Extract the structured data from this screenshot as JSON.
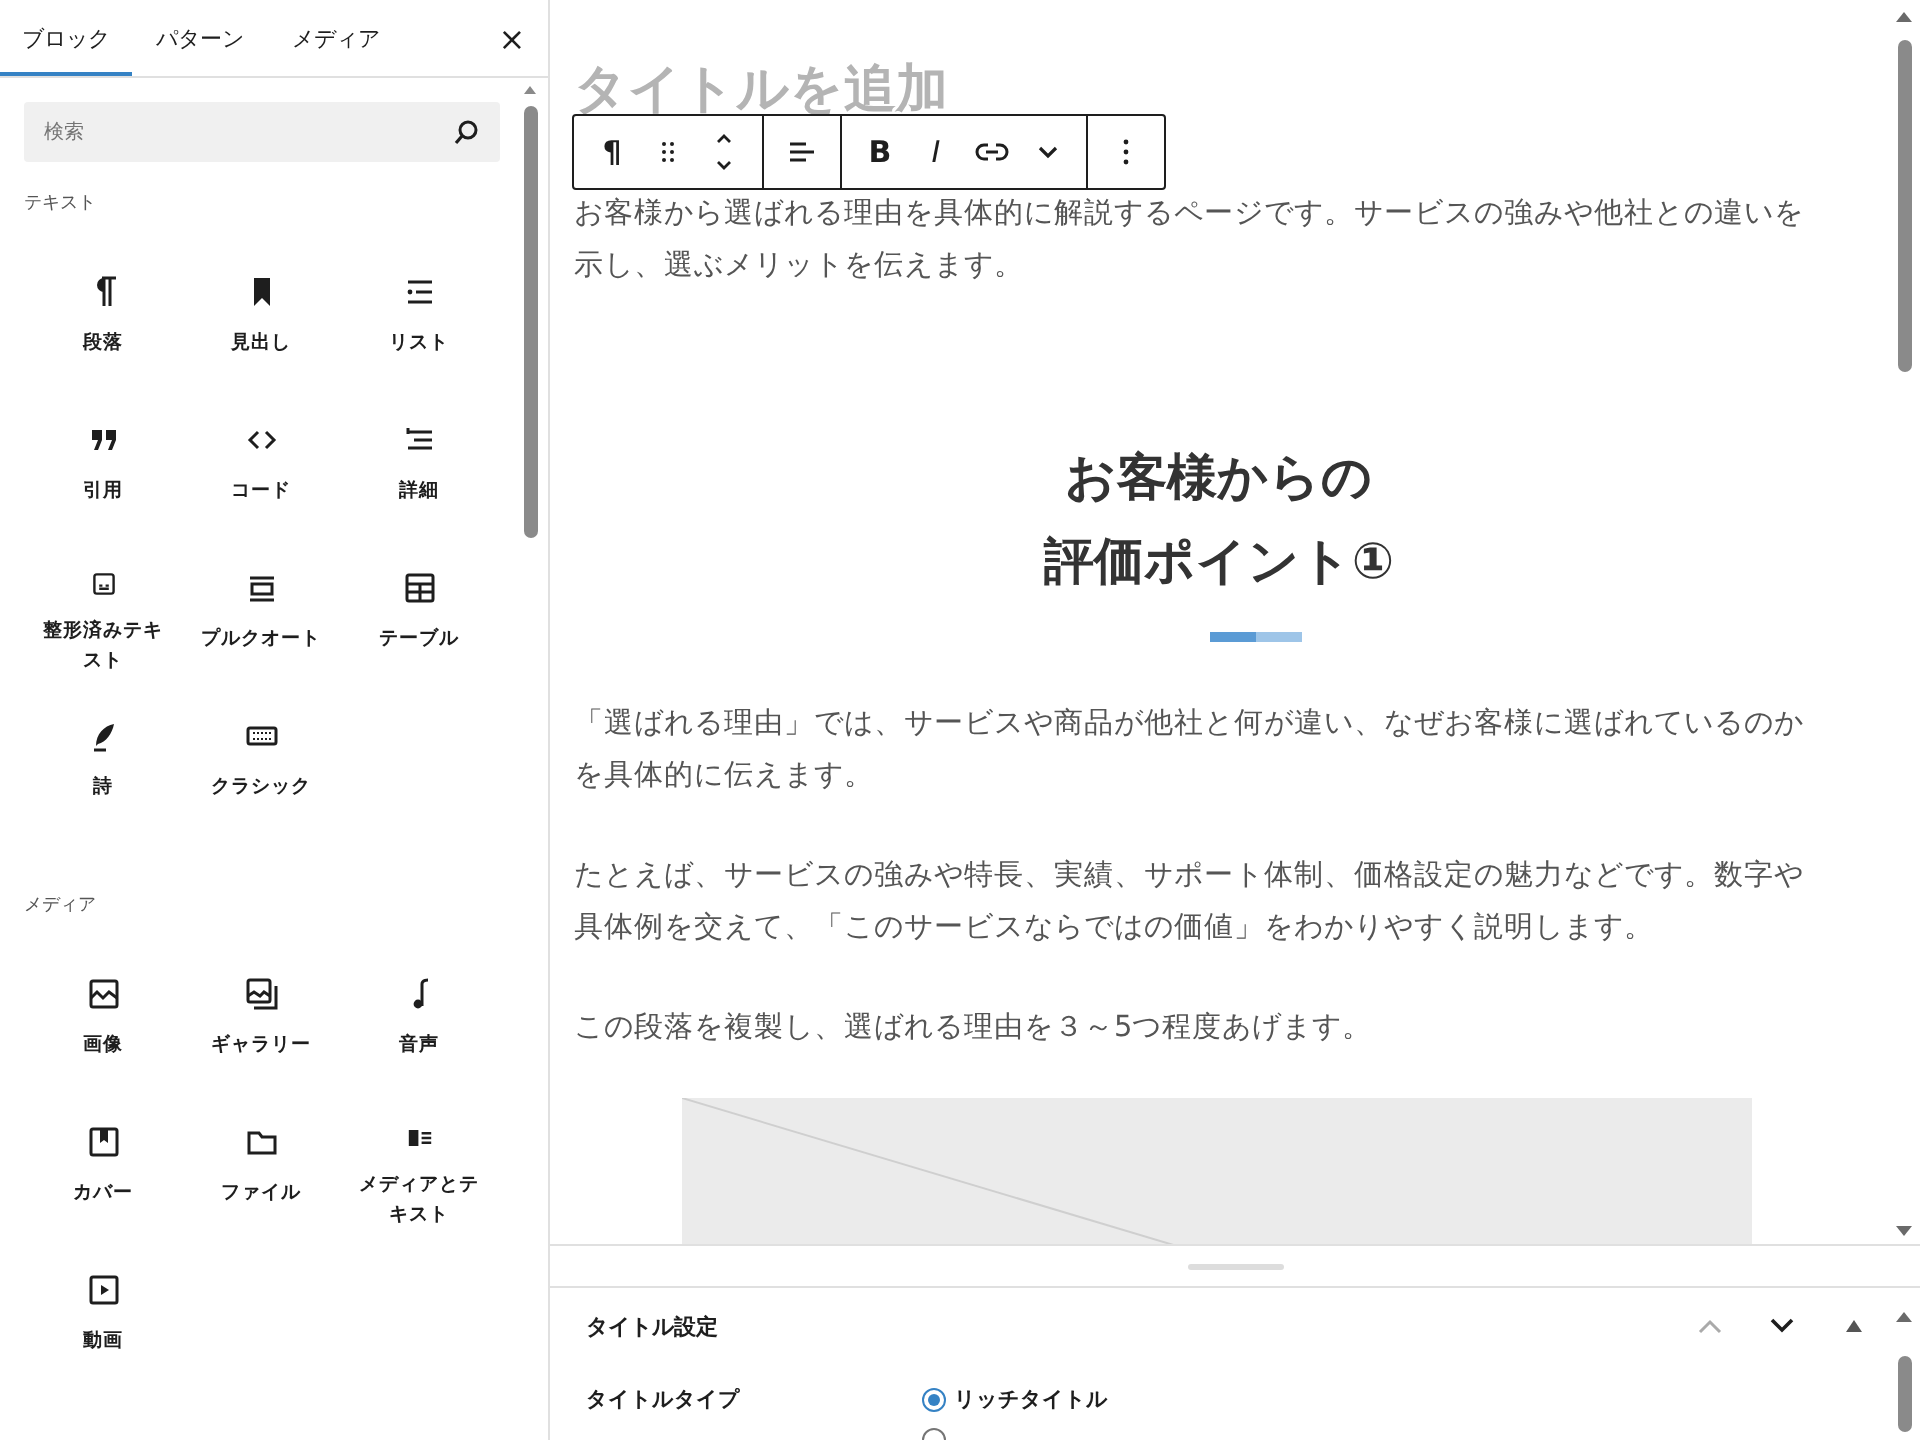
{
  "sidebar": {
    "tabs": [
      {
        "label": "ブロック",
        "selected": true
      },
      {
        "label": "パターン",
        "selected": false
      },
      {
        "label": "メディア",
        "selected": false
      }
    ],
    "close": "×",
    "search": {
      "placeholder": "検索"
    },
    "sections": [
      {
        "title": "テキスト",
        "items": [
          {
            "label": "段落",
            "kind": "paragraph"
          },
          {
            "label": "見出し",
            "kind": "heading"
          },
          {
            "label": "リスト",
            "kind": "list"
          },
          {
            "label": "引用",
            "kind": "quote"
          },
          {
            "label": "コード",
            "kind": "code"
          },
          {
            "label": "詳細",
            "kind": "details"
          },
          {
            "label": "整形済みテキスト",
            "kind": "preformatted"
          },
          {
            "label": "プルクオート",
            "kind": "pullquote"
          },
          {
            "label": "テーブル",
            "kind": "table"
          },
          {
            "label": "詩",
            "kind": "verse"
          },
          {
            "label": "クラシック",
            "kind": "classic"
          }
        ]
      },
      {
        "title": "メディア",
        "items": [
          {
            "label": "画像",
            "kind": "image"
          },
          {
            "label": "ギャラリー",
            "kind": "gallery"
          },
          {
            "label": "音声",
            "kind": "audio"
          },
          {
            "label": "カバー",
            "kind": "cover"
          },
          {
            "label": "ファイル",
            "kind": "file"
          },
          {
            "label": "メディアとテキスト",
            "kind": "mediatext"
          },
          {
            "label": "動画",
            "kind": "video"
          }
        ]
      }
    ]
  },
  "editor": {
    "title_placeholder": "タイトルを追加",
    "toolbar": [
      [
        {
          "kind": "text",
          "label": "¶"
        },
        {
          "kind": "drag"
        },
        {
          "kind": "move"
        }
      ],
      [
        {
          "kind": "align"
        }
      ],
      [
        {
          "kind": "bold",
          "label": "B"
        },
        {
          "kind": "italic",
          "label": "I"
        },
        {
          "kind": "link"
        },
        {
          "kind": "dropdown"
        }
      ],
      [
        {
          "kind": "options"
        }
      ]
    ],
    "intro": "お客様から選ばれる理由を具体的に解説するページです。サービスの強みや他社との違いを示し、選ぶメリットを伝えます。",
    "heading": [
      "お客様からの",
      "評価ポイント①"
    ],
    "paragraphs": [
      "「選ばれる理由」では、サービスや商品が他社と何が違い、なぜお客様に選ばれているのかを具体的に伝えます。",
      "たとえば、サービスの強みや特長、実績、サポート体制、価格設定の魅力などです。数字や具体例を交えて、「このサービスならではの価値」をわかりやすく説明します。",
      "この段落を複製し、選ばれる理由を３～5つ程度あげます。"
    ],
    "image_placeholder": {
      "kind": "placeholder"
    }
  },
  "settings": {
    "title": "タイトル設定",
    "field_label": "タイトルタイプ",
    "options": [
      {
        "label": "リッチタイトル",
        "selected": true
      },
      {
        "selected": false
      }
    ]
  }
}
